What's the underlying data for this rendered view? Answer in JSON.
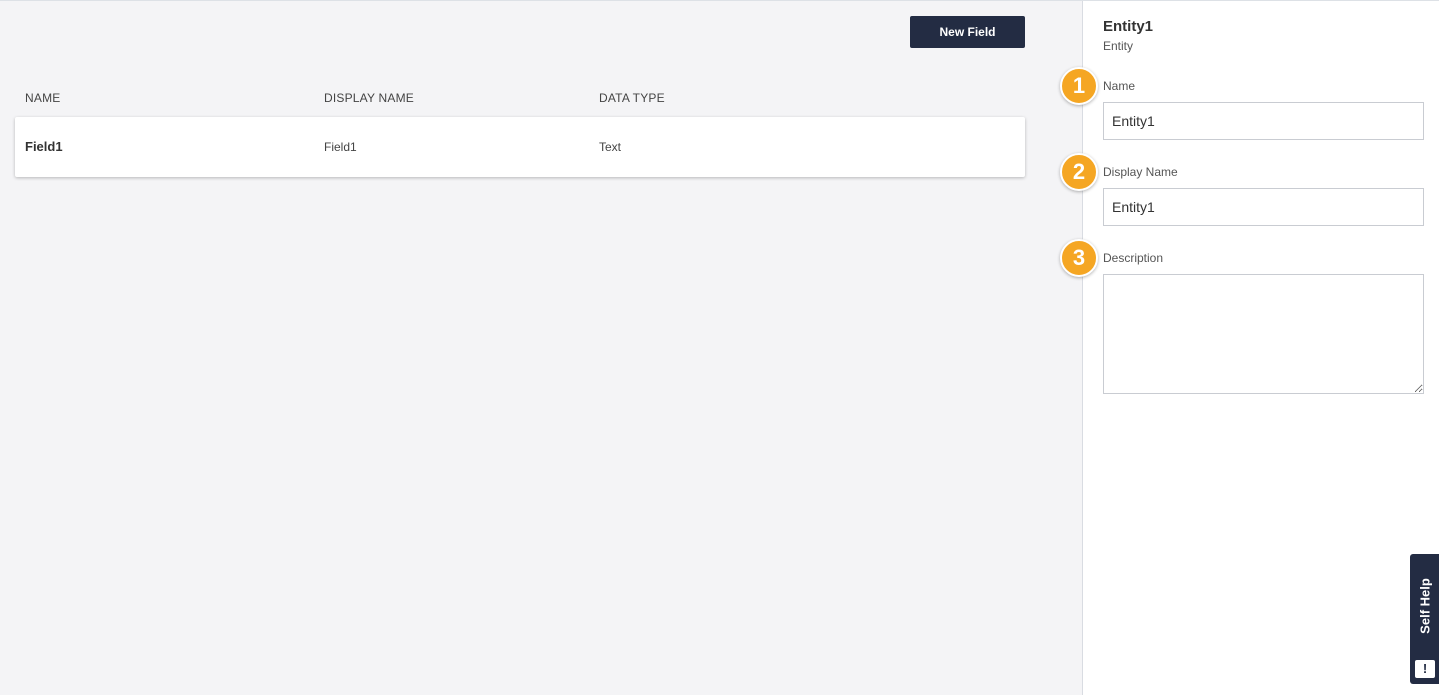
{
  "toolbar": {
    "new_field_label": "New Field"
  },
  "table": {
    "columns": [
      "NAME",
      "DISPLAY NAME",
      "DATA TYPE"
    ],
    "rows": [
      {
        "name": "Field1",
        "display_name": "Field1",
        "data_type": "Text"
      }
    ]
  },
  "panel": {
    "title": "Entity1",
    "subtitle": "Entity",
    "name_label": "Name",
    "name_value": "Entity1",
    "display_name_label": "Display Name",
    "display_name_value": "Entity1",
    "description_label": "Description",
    "description_value": ""
  },
  "steps": [
    "1",
    "2",
    "3"
  ],
  "self_help": {
    "label": "Self Help",
    "icon": "chat-alert-icon",
    "icon_glyph": "!"
  },
  "colors": {
    "primary": "#232c43",
    "step_badge": "#f5a623",
    "background": "#f4f4f6"
  }
}
